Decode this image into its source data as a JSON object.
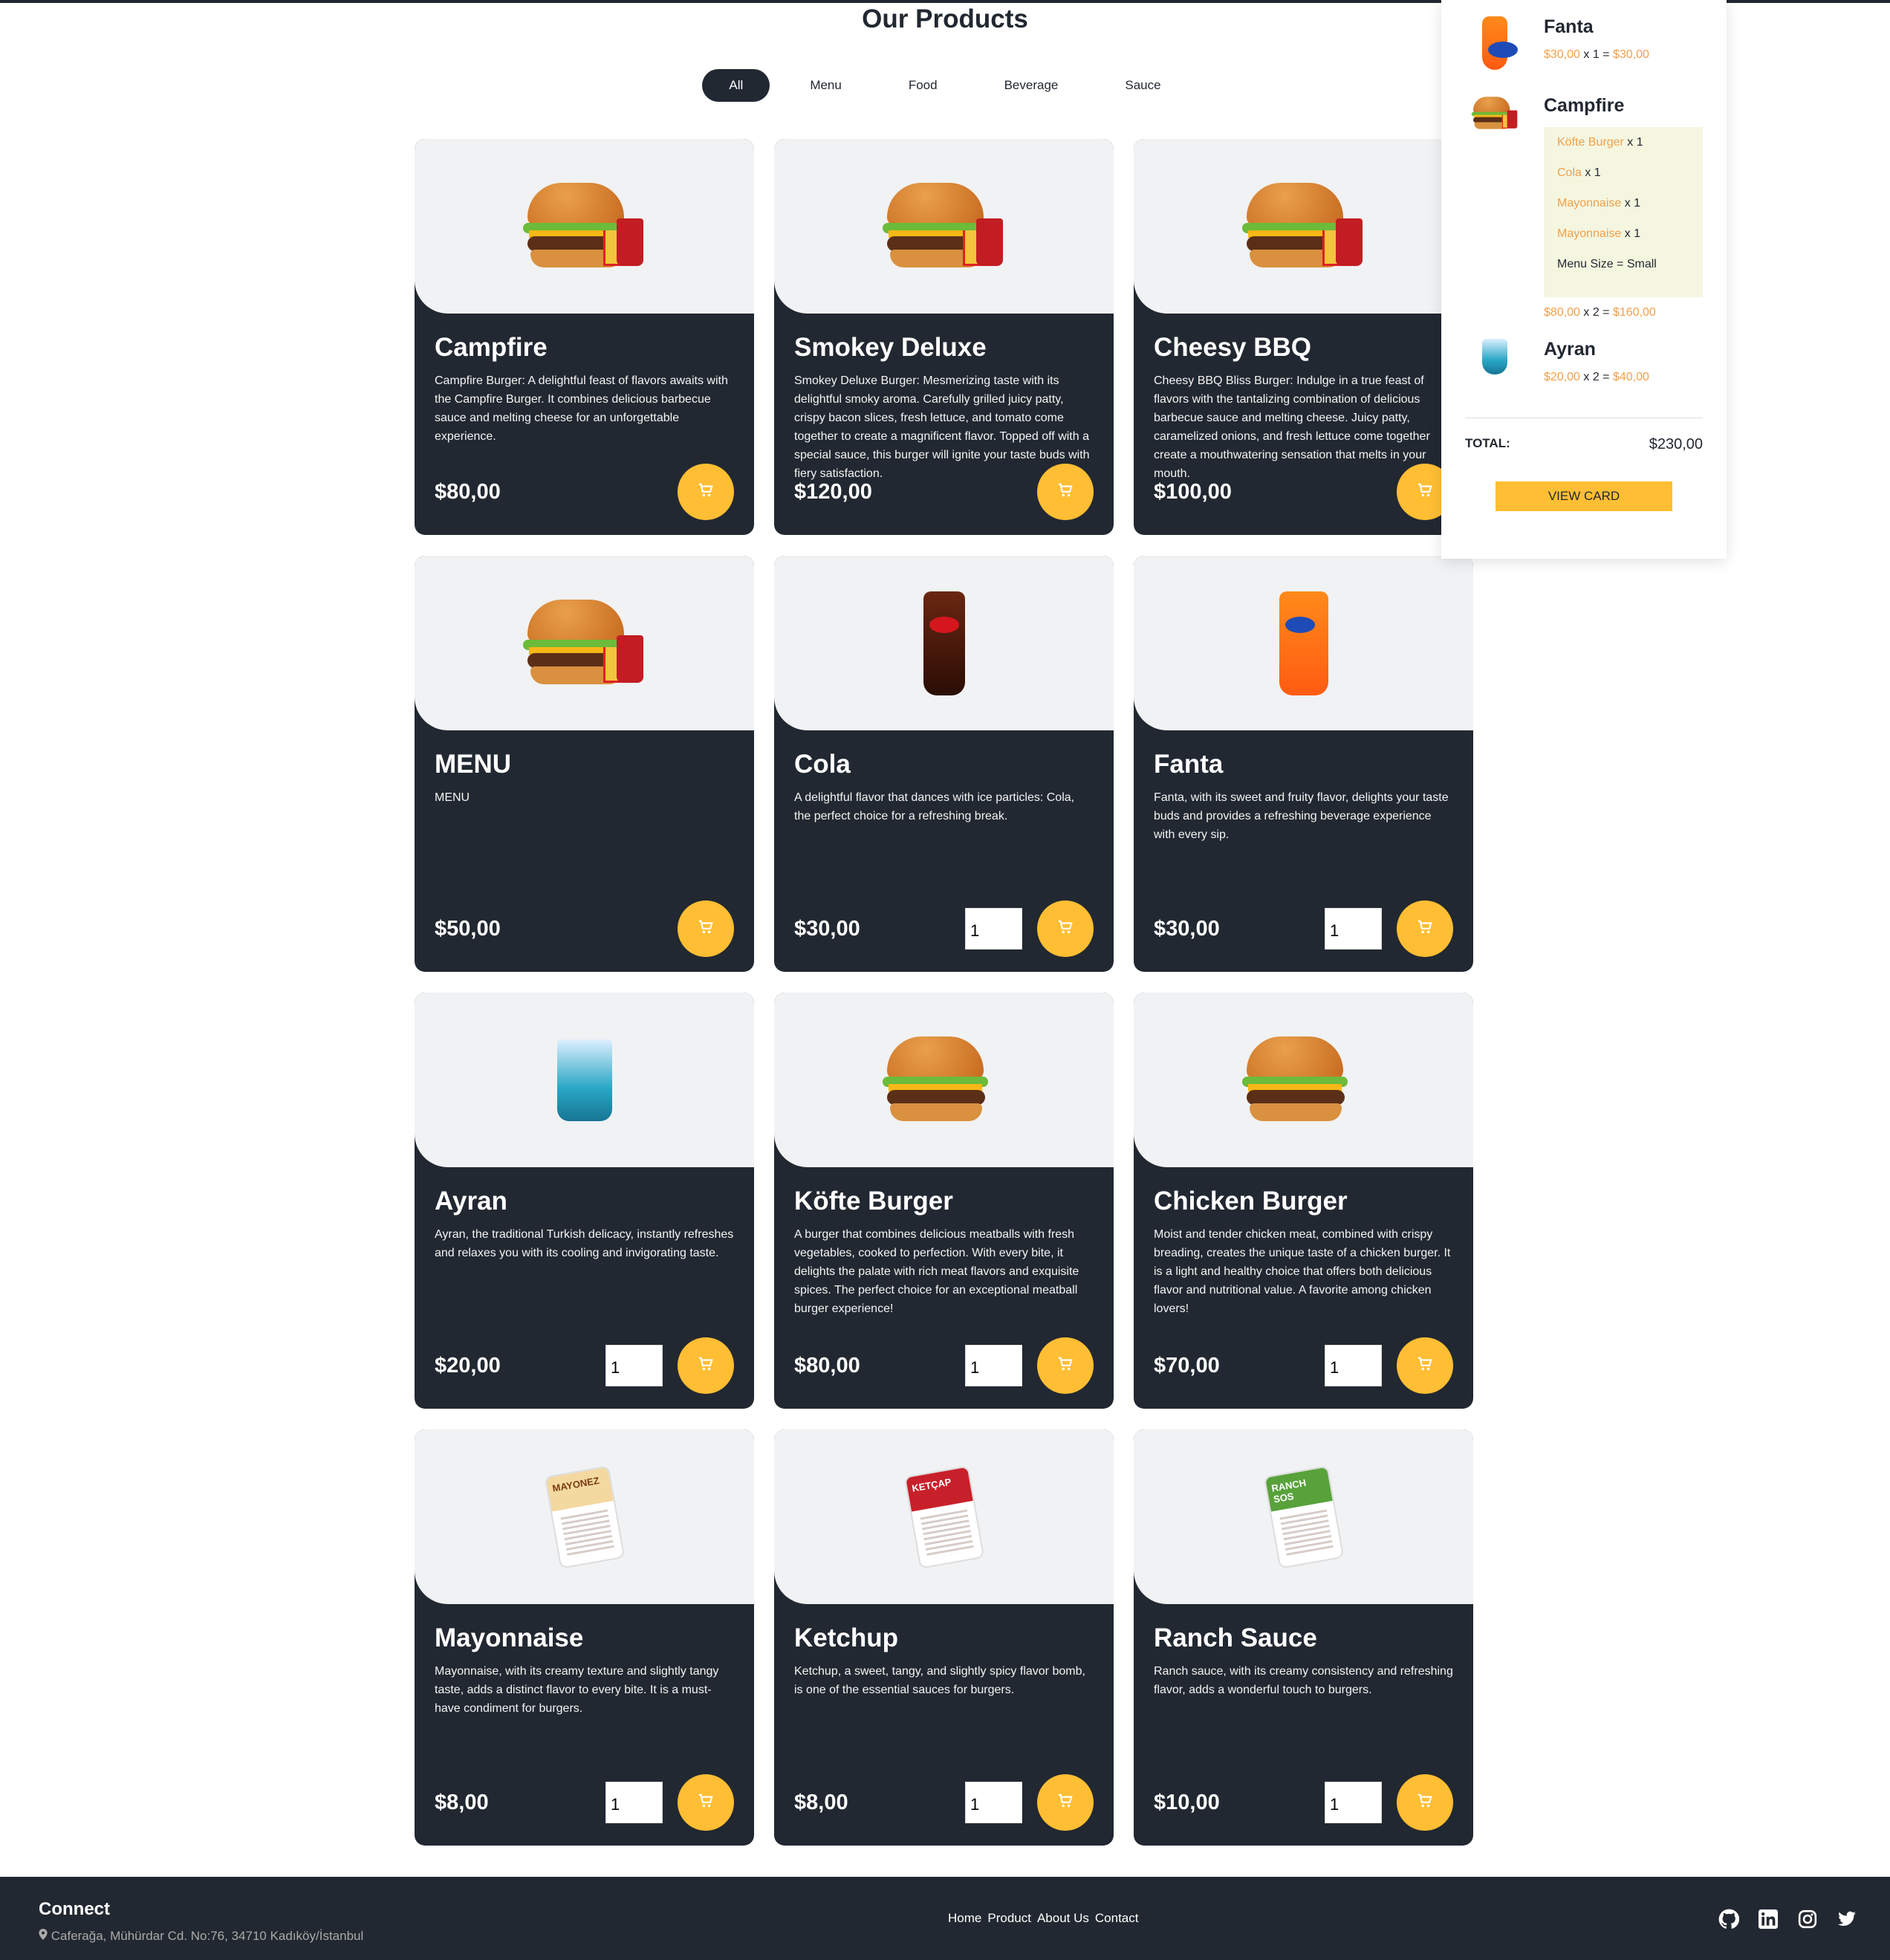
{
  "page_title": "Our Products",
  "filters": [
    {
      "label": "All",
      "active": true
    },
    {
      "label": "Menu",
      "active": false
    },
    {
      "label": "Food",
      "active": false
    },
    {
      "label": "Beverage",
      "active": false
    },
    {
      "label": "Sauce",
      "active": false
    }
  ],
  "products": [
    {
      "name": "Campfire",
      "description": "Campfire Burger: A delightful feast of flavors awaits with the Campfire Burger. It combines delicious barbecue sauce and melting cheese for an unforgettable experience.",
      "price": "$80,00",
      "qty": null,
      "image": "burger-menu-icon"
    },
    {
      "name": "Smokey Deluxe",
      "description": "Smokey Deluxe Burger: Mesmerizing taste with its delightful smoky aroma. Carefully grilled juicy patty, crispy bacon slices, fresh lettuce, and tomato come together to create a magnificent flavor. Topped off with a special sauce, this burger will ignite your taste buds with fiery satisfaction.",
      "price": "$120,00",
      "qty": null,
      "image": "burger-menu-icon"
    },
    {
      "name": "Cheesy BBQ",
      "description": "Cheesy BBQ Bliss Burger: Indulge in a true feast of flavors with the tantalizing combination of delicious barbecue sauce and melting cheese. Juicy patty, caramelized onions, and fresh lettuce come together create a mouthwatering sensation that melts in your mouth.",
      "price": "$100,00",
      "qty": null,
      "image": "burger-menu-icon"
    },
    {
      "name": "MENU",
      "description": "MENU",
      "price": "$50,00",
      "qty": null,
      "image": "burger-menu-icon"
    },
    {
      "name": "Cola",
      "description": "A delightful flavor that dances with ice particles: Cola, the perfect choice for a refreshing break.",
      "price": "$30,00",
      "qty": "1",
      "image": "cola-icon"
    },
    {
      "name": "Fanta",
      "description": "Fanta, with its sweet and fruity flavor, delights your taste buds and provides a refreshing beverage experience with every sip.",
      "price": "$30,00",
      "qty": "1",
      "image": "fanta-icon"
    },
    {
      "name": "Ayran",
      "description": "Ayran, the traditional Turkish delicacy, instantly refreshes and relaxes you with its cooling and invigorating taste.",
      "price": "$20,00",
      "qty": "1",
      "image": "ayran-icon"
    },
    {
      "name": "Köfte Burger",
      "description": "A burger that combines delicious meatballs with fresh vegetables, cooked to perfection. With every bite, it delights the palate with rich meat flavors and exquisite spices. The perfect choice for an exceptional meatball burger experience!",
      "price": "$80,00",
      "qty": "1",
      "image": "burger-icon"
    },
    {
      "name": "Chicken Burger",
      "description": "Moist and tender chicken meat, combined with crispy breading, creates the unique taste of a chicken burger. It is a light and healthy choice that offers both delicious flavor and nutritional value. A favorite among chicken lovers!",
      "price": "$70,00",
      "qty": "1",
      "image": "burger-icon"
    },
    {
      "name": "Mayonnaise",
      "description": "Mayonnaise, with its creamy texture and slightly tangy taste, adds a distinct flavor to every bite. It is a must-have condiment for burgers.",
      "price": "$8,00",
      "qty": "1",
      "image": "mayonnaise-pack-icon",
      "pack_label": "MAYONEZ",
      "pack_color": "#f3d9a0"
    },
    {
      "name": "Ketchup",
      "description": "Ketchup, a sweet, tangy, and slightly spicy flavor bomb, is one of the essential sauces for burgers.",
      "price": "$8,00",
      "qty": "1",
      "image": "ketchup-pack-icon",
      "pack_label": "KETÇAP",
      "pack_color": "#c8202a"
    },
    {
      "name": "Ranch Sauce",
      "description": "Ranch sauce, with its creamy consistency and refreshing flavor, adds a wonderful touch to burgers.",
      "price": "$10,00",
      "qty": "1",
      "image": "ranch-pack-icon",
      "pack_label": "RANCH SOS",
      "pack_color": "#58a23b"
    }
  ],
  "cart": {
    "items": [
      {
        "name": "Fanta",
        "unit": "$30,00",
        "mult": "x 1 =",
        "total": "$30,00",
        "image": "fanta-icon"
      },
      {
        "name": "Campfire",
        "unit": "$80,00",
        "mult": "x 2 =",
        "total": "$160,00",
        "image": "burger-menu-icon",
        "sub": [
          {
            "name": "Köfte Burger",
            "rest": "x 1"
          },
          {
            "name": "Cola",
            "rest": "x 1"
          },
          {
            "name": "Mayonnaise",
            "rest": "x 1"
          },
          {
            "name": "Mayonnaise",
            "rest": "x 1"
          },
          {
            "name": "",
            "rest": "Menu Size = Small"
          }
        ]
      },
      {
        "name": "Ayran",
        "unit": "$20,00",
        "mult": "x 2 =",
        "total": "$40,00",
        "image": "ayran-icon"
      }
    ],
    "total_label": "TOTAL:",
    "total_value": "$230,00",
    "view_button": "VIEW CARD"
  },
  "footer": {
    "connect": "Connect",
    "address": "Caferağa, Mühürdar Cd. No:76, 34710 Kadıköy/İstanbul",
    "links": [
      "Home",
      "Product",
      "About Us",
      "Contact"
    ],
    "socials": [
      "github-icon",
      "linkedin-icon",
      "instagram-icon",
      "twitter-icon"
    ]
  },
  "colors": {
    "dark": "#222831",
    "accent": "#ffbe33",
    "highlight": "#f0a04b",
    "light_bg": "#f1f2f3"
  }
}
